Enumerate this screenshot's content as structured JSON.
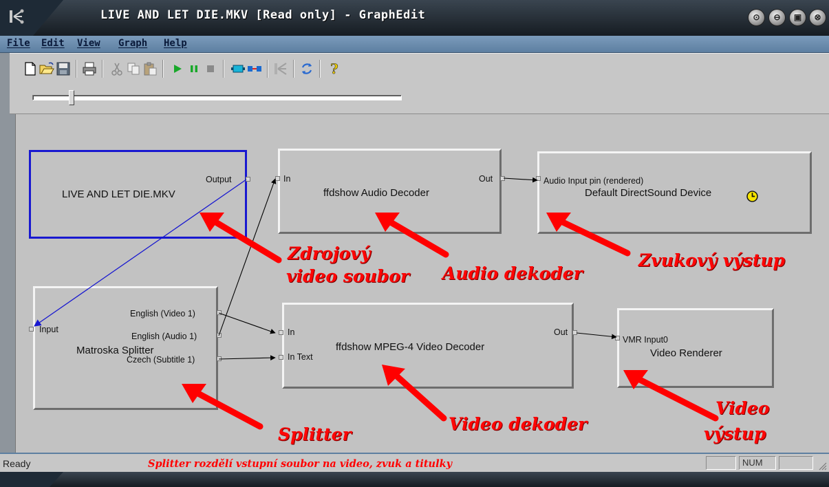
{
  "window": {
    "title": "LIVE AND LET DIE.MKV [Read only] - GraphEdit",
    "buttons": [
      "minimize-icon",
      "restore-icon",
      "maximize-icon",
      "close-icon"
    ]
  },
  "menu": [
    "File",
    "Edit",
    "View",
    "Graph",
    "Help"
  ],
  "toolbar": {
    "icons": [
      "new-icon",
      "open-icon",
      "save-icon",
      "print-icon",
      "cut-icon",
      "copy-icon",
      "paste-icon",
      "play-icon",
      "pause-icon",
      "stop-icon",
      "insert-filter-icon",
      "connect-icon",
      "renderer-icon",
      "refresh-icon",
      "help-icon"
    ]
  },
  "graph": {
    "filters": {
      "source": {
        "name": "LIVE AND LET DIE.MKV",
        "pins": {
          "output": "Output"
        }
      },
      "splitter": {
        "name": "Matroska Splitter",
        "pins": {
          "input": "Input",
          "video": "English (Video 1)",
          "audio": "English (Audio 1)",
          "subtitle": "Czech (Subtitle 1)"
        }
      },
      "audio_decoder": {
        "name": "ffdshow Audio Decoder",
        "pins": {
          "in": "In",
          "out": "Out"
        }
      },
      "audio_renderer": {
        "name": "Default DirectSound Device",
        "pins": {
          "in": "Audio Input pin (rendered)"
        }
      },
      "video_decoder": {
        "name": "ffdshow MPEG-4 Video Decoder",
        "pins": {
          "in": "In",
          "in_text": "In Text",
          "out": "Out"
        }
      },
      "video_renderer": {
        "name": "Video Renderer",
        "pins": {
          "in": "VMR Input0"
        }
      }
    },
    "annotations": {
      "source": [
        "Zdrojový",
        "video soubor"
      ],
      "audio_decoder": "Audio dekoder",
      "audio_output": "Zvukový výstup",
      "splitter": "Splitter",
      "video_decoder": "Video dekoder",
      "video_output": [
        "Video",
        "výstup"
      ]
    }
  },
  "status": {
    "ready": "Ready",
    "note": "Splitter rozdělí vstupní soubor na video, zvuk a titulky",
    "num": "NUM"
  },
  "colors": {
    "selected_border": "#1818d0",
    "annotation": "#ff0606",
    "canvas": "#c2c2c2"
  }
}
